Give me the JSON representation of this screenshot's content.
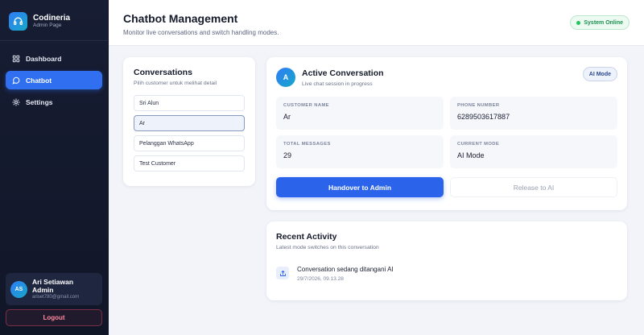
{
  "brand": {
    "name": "Codineria",
    "subtitle": "Admin Page"
  },
  "nav": [
    {
      "label": "Dashboard",
      "icon": "grid-icon",
      "active": false
    },
    {
      "label": "Chatbot",
      "icon": "chat-icon",
      "active": true
    },
    {
      "label": "Settings",
      "icon": "gear-icon",
      "active": false
    }
  ],
  "user": {
    "initials": "AS",
    "name": "Ari Setiawan",
    "role": "Admin",
    "email": "ariset780@gmail.com"
  },
  "logout_label": "Logout",
  "header": {
    "title": "Chatbot Management",
    "subtitle": "Monitor live conversations and switch handling modes.",
    "status": "System Online"
  },
  "conversations": {
    "title": "Conversations",
    "subtitle": "Pilih customer untuk melihat detail",
    "items": [
      "Sri Alun",
      "Ar",
      "Pelanggan WhatsApp",
      "Test Customer"
    ],
    "selected_index": 1
  },
  "active": {
    "avatar_letter": "A",
    "title": "Active Conversation",
    "subtitle": "Live chat session in progress",
    "mode_badge": "AI Mode",
    "fields": [
      {
        "label": "CUSTOMER NAME",
        "value": "Ar"
      },
      {
        "label": "PHONE NUMBER",
        "value": "6289503617887"
      },
      {
        "label": "TOTAL MESSAGES",
        "value": "29"
      },
      {
        "label": "CURRENT MODE",
        "value": "AI Mode"
      }
    ],
    "handover_label": "Handover to Admin",
    "release_label": "Release to AI"
  },
  "activity": {
    "title": "Recent Activity",
    "subtitle": "Latest mode switches on this conversation",
    "items": [
      {
        "text": "Conversation sedang ditangani AI",
        "time": "29/7/2026, 09.13.28"
      }
    ]
  },
  "colors": {
    "accent": "#2b64ea",
    "sidebar": "#171d33",
    "online": "#22c55e"
  }
}
